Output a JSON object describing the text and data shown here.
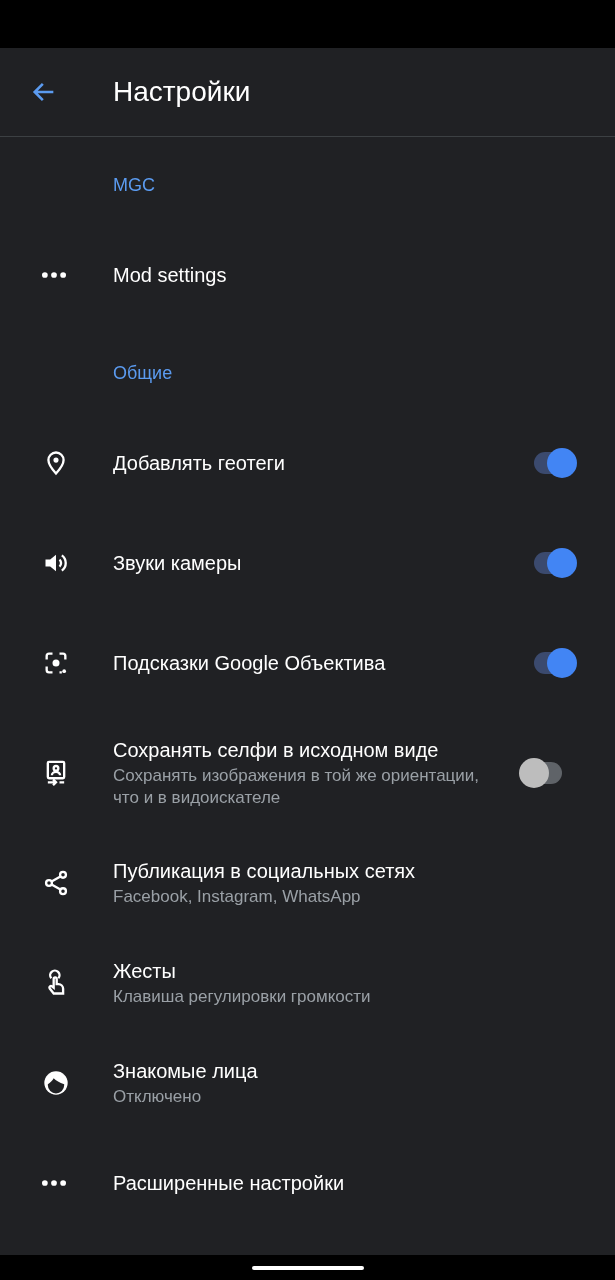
{
  "app_bar": {
    "title": "Настройки"
  },
  "sections": [
    {
      "header": "MGC",
      "rows": [
        {
          "kind": "link",
          "title": "Mod settings"
        }
      ]
    },
    {
      "header": "Общие",
      "rows": [
        {
          "kind": "switch",
          "title": "Добавлять геотеги",
          "on": true
        },
        {
          "kind": "switch",
          "title": "Звуки камеры",
          "on": true
        },
        {
          "kind": "switch",
          "title": "Подсказки Google Объектива",
          "on": true
        },
        {
          "kind": "switch",
          "title": "Сохранять селфи в исходном виде",
          "summary": "Сохранять изображения в той же ориентации, что и в видоискателе",
          "on": false
        },
        {
          "kind": "link",
          "title": "Публикация в социальных сетях",
          "summary": "Facebook, Instagram, WhatsApp"
        },
        {
          "kind": "link",
          "title": "Жесты",
          "summary": "Клавиша регулировки громкости"
        },
        {
          "kind": "link",
          "title": "Знакомые лица",
          "summary": "Отключено"
        },
        {
          "kind": "link",
          "title": "Расширенные настройки"
        }
      ]
    }
  ]
}
